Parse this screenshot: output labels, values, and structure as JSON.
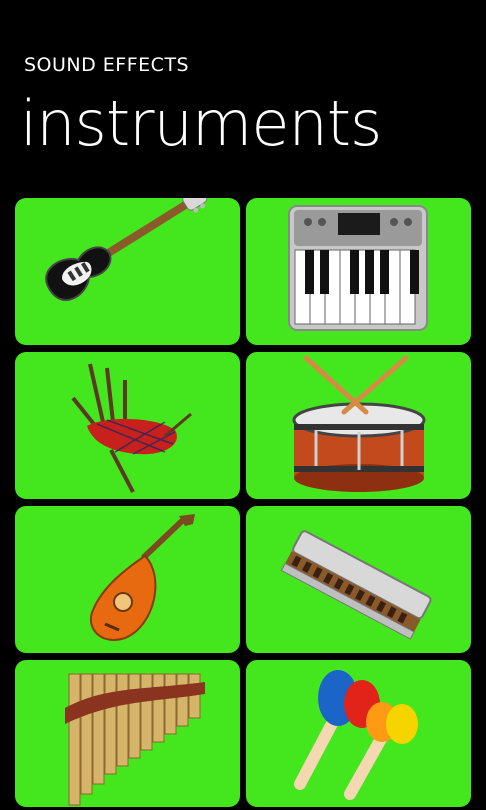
{
  "header": {
    "app_title": "SOUND EFFECTS",
    "page_title": "instruments"
  },
  "tiles": [
    {
      "icon": "electric-guitar-icon"
    },
    {
      "icon": "synthesizer-keyboard-icon"
    },
    {
      "icon": "bagpipes-icon"
    },
    {
      "icon": "drum-icon"
    },
    {
      "icon": "lute-icon"
    },
    {
      "icon": "harmonica-icon"
    },
    {
      "icon": "pan-flute-icon"
    },
    {
      "icon": "maracas-icon"
    }
  ],
  "colors": {
    "background": "#000000",
    "tile": "#44e61e",
    "text": "#ffffff"
  }
}
